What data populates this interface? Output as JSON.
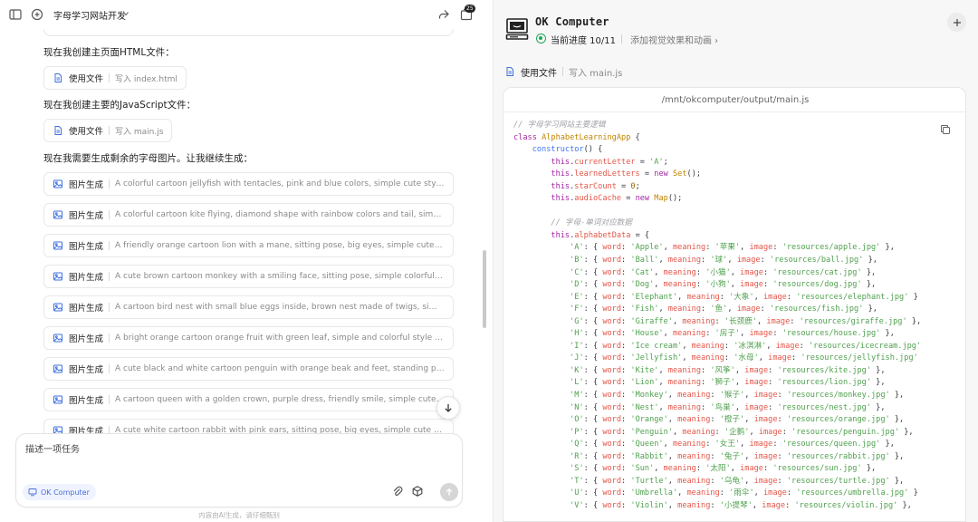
{
  "topbar": {
    "title": "字母学习网站开发",
    "badge_count": "25"
  },
  "chat": {
    "messages": [
      "现在我创建主页面HTML文件：",
      "现在我创建主要的JavaScript文件：",
      "现在我需要生成剩余的字母图片。让我继续生成："
    ],
    "file_tools": [
      {
        "label": "使用文件",
        "detail": "写入 index.html"
      },
      {
        "label": "使用文件",
        "detail": "写入 main.js"
      }
    ],
    "image_tools": [
      {
        "label": "图片生成",
        "detail": "A colorful cartoon jellyfish with tentacles, pink and blue colors, simple cute style for chil..."
      },
      {
        "label": "图片生成",
        "detail": "A colorful cartoon kite flying, diamond shape with rainbow colors and tail, simple cute st..."
      },
      {
        "label": "图片生成",
        "detail": "A friendly orange cartoon lion with a mane, sitting pose, big eyes, simple cute style for c..."
      },
      {
        "label": "图片生成",
        "detail": "A cute brown cartoon monkey with a smiling face, sitting pose, simple colorful style for ..."
      },
      {
        "label": "图片生成",
        "detail": "A cartoon bird nest with small blue eggs inside, brown nest made of twigs, simple cute s..."
      },
      {
        "label": "图片生成",
        "detail": "A bright orange cartoon orange fruit with green leaf, simple and colorful style for childre..."
      },
      {
        "label": "图片生成",
        "detail": "A cute black and white cartoon penguin with orange beak and feet, standing pose, simpl..."
      },
      {
        "label": "图片生成",
        "detail": "A cartoon queen with a golden crown, purple dress, friendly smile, simple cute style for ..."
      },
      {
        "label": "图片生成",
        "detail": "A cute white cartoon rabbit with pink ears, sitting pose, big eyes, simple cute style for childre..."
      }
    ]
  },
  "composer": {
    "placeholder": "描述一项任务",
    "agent_label": "OK Computer"
  },
  "footer_note": "内容由AI生成，请仔细甄别",
  "right": {
    "app_name": "OK Computer",
    "progress": "当前进度 10/11",
    "next_step": "添加视觉效果和动画 ›",
    "tool_label": "使用文件",
    "tool_detail": "写入 main.js",
    "file_path": "/mnt/okcomputer/output/main.js",
    "code": {
      "comment1": "// 字母学习网站主要逻辑",
      "class_name": "AlphabetLearningApp",
      "ctor": "constructor",
      "current_letter": "'A'",
      "star_count": "0",
      "comment2": "// 字母-单词对应数据",
      "letters": [
        {
          "k": "'A'",
          "word": "'Apple'",
          "meaning": "'苹果'",
          "image": "'resources/apple.jpg'",
          "end": " },"
        },
        {
          "k": "'B'",
          "word": "'Ball'",
          "meaning": "'球'",
          "image": "'resources/ball.jpg'",
          "end": " },"
        },
        {
          "k": "'C'",
          "word": "'Cat'",
          "meaning": "'小猫'",
          "image": "'resources/cat.jpg'",
          "end": " },"
        },
        {
          "k": "'D'",
          "word": "'Dog'",
          "meaning": "'小狗'",
          "image": "'resources/dog.jpg'",
          "end": " },"
        },
        {
          "k": "'E'",
          "word": "'Elephant'",
          "meaning": "'大象'",
          "image": "'resources/elephant.jpg'",
          "end": " }"
        },
        {
          "k": "'F'",
          "word": "'Fish'",
          "meaning": "'鱼'",
          "image": "'resources/fish.jpg'",
          "end": " },"
        },
        {
          "k": "'G'",
          "word": "'Giraffe'",
          "meaning": "'长颈鹿'",
          "image": "'resources/giraffe.jpg'",
          "end": " },"
        },
        {
          "k": "'H'",
          "word": "'House'",
          "meaning": "'房子'",
          "image": "'resources/house.jpg'",
          "end": " },"
        },
        {
          "k": "'I'",
          "word": "'Ice cream'",
          "meaning": "'冰淇淋'",
          "image": "'resources/icecream.jpg'",
          "end": ""
        },
        {
          "k": "'J'",
          "word": "'Jellyfish'",
          "meaning": "'水母'",
          "image": "'resources/jellyfish.jpg'",
          "end": ""
        },
        {
          "k": "'K'",
          "word": "'Kite'",
          "meaning": "'风筝'",
          "image": "'resources/kite.jpg'",
          "end": " },"
        },
        {
          "k": "'L'",
          "word": "'Lion'",
          "meaning": "'狮子'",
          "image": "'resources/lion.jpg'",
          "end": " },"
        },
        {
          "k": "'M'",
          "word": "'Monkey'",
          "meaning": "'猴子'",
          "image": "'resources/monkey.jpg'",
          "end": " },"
        },
        {
          "k": "'N'",
          "word": "'Nest'",
          "meaning": "'鸟巢'",
          "image": "'resources/nest.jpg'",
          "end": " },"
        },
        {
          "k": "'O'",
          "word": "'Orange'",
          "meaning": "'橙子'",
          "image": "'resources/orange.jpg'",
          "end": " },"
        },
        {
          "k": "'P'",
          "word": "'Penguin'",
          "meaning": "'企鹅'",
          "image": "'resources/penguin.jpg'",
          "end": " },"
        },
        {
          "k": "'Q'",
          "word": "'Queen'",
          "meaning": "'女王'",
          "image": "'resources/queen.jpg'",
          "end": " },"
        },
        {
          "k": "'R'",
          "word": "'Rabbit'",
          "meaning": "'兔子'",
          "image": "'resources/rabbit.jpg'",
          "end": " },"
        },
        {
          "k": "'S'",
          "word": "'Sun'",
          "meaning": "'太阳'",
          "image": "'resources/sun.jpg'",
          "end": " },"
        },
        {
          "k": "'T'",
          "word": "'Turtle'",
          "meaning": "'乌龟'",
          "image": "'resources/turtle.jpg'",
          "end": " },"
        },
        {
          "k": "'U'",
          "word": "'Umbrella'",
          "meaning": "'雨伞'",
          "image": "'resources/umbrella.jpg'",
          "end": " }"
        },
        {
          "k": "'V'",
          "word": "'Violin'",
          "meaning": "'小提琴'",
          "image": "'resources/violin.jpg'",
          "end": " },"
        }
      ]
    }
  }
}
